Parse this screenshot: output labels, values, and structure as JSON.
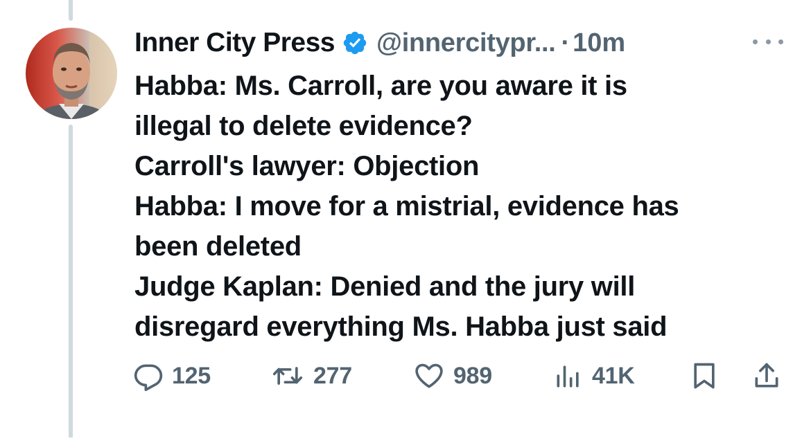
{
  "author": {
    "display_name": "Inner City Press",
    "handle": "@innercitypr...",
    "separator": "·",
    "time": "10m",
    "verified": true,
    "verified_color": "#1d9bf0",
    "avatar_icon": "author-avatar-photo"
  },
  "tweet": {
    "lines": [
      "Habba: Ms. Carroll, are you aware it is",
      "illegal to delete evidence?",
      "Carroll's lawyer: Objection",
      "Habba: I move for a mistrial, evidence has",
      "been deleted",
      "Judge Kaplan: Denied and the jury will",
      "disregard everything Ms. Habba just said"
    ]
  },
  "actions": {
    "reply": {
      "icon": "reply-icon",
      "count": "125"
    },
    "retweet": {
      "icon": "retweet-icon",
      "count": "277"
    },
    "like": {
      "icon": "heart-icon",
      "count": "989"
    },
    "views": {
      "icon": "views-chart-icon",
      "count": "41K"
    },
    "bookmark": {
      "icon": "bookmark-icon"
    },
    "share": {
      "icon": "share-icon"
    }
  },
  "colors": {
    "text_primary": "#0f1419",
    "text_secondary": "#536471",
    "thread_line": "#cfd9de",
    "accent": "#1d9bf0"
  }
}
